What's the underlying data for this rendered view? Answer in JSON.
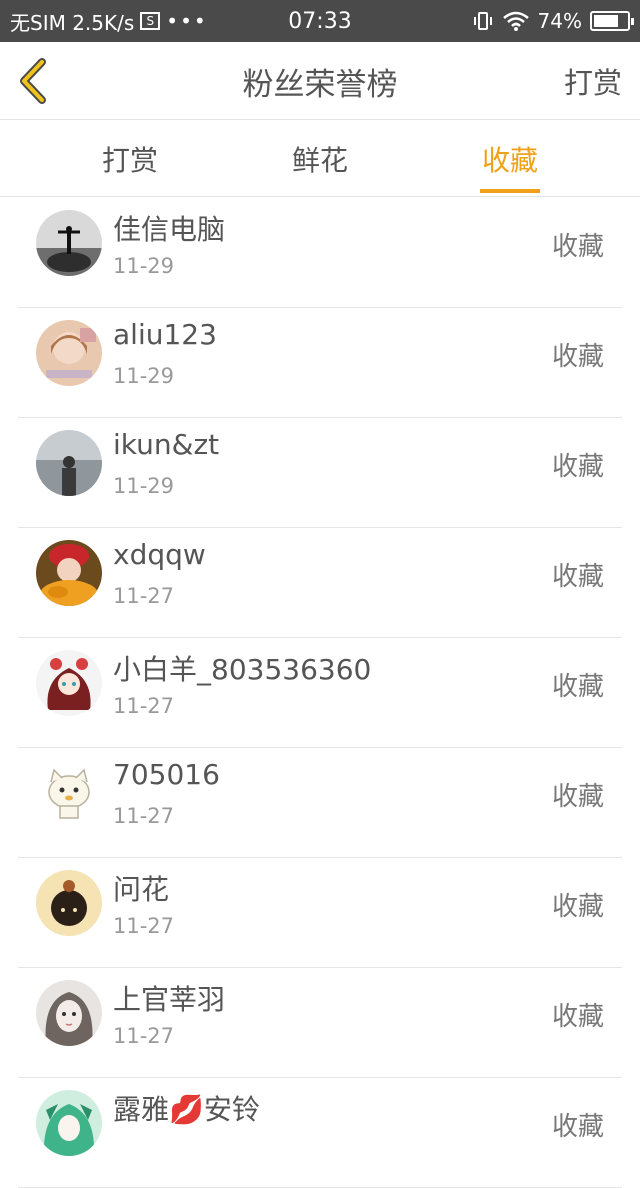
{
  "status_bar": {
    "carrier": "无SIM 2.5K/s",
    "sim_icon_label": "S",
    "more_dots": "•••",
    "time": "07:33",
    "battery": "74%",
    "battery_level": 0.74
  },
  "nav": {
    "title": "粉丝荣誉榜",
    "right_action": "打赏"
  },
  "tabs": [
    {
      "label": "打赏",
      "active": false
    },
    {
      "label": "鲜花",
      "active": false
    },
    {
      "label": "收藏",
      "active": true
    }
  ],
  "colors": {
    "accent": "#f0a11a",
    "status_bg": "#4a4a4a"
  },
  "fans": [
    {
      "name": "佳信电脑",
      "date": "11-29",
      "action": "收藏"
    },
    {
      "name": "aliu123",
      "date": "11-29",
      "action": "收藏"
    },
    {
      "name": "ikun&zt",
      "date": "11-29",
      "action": "收藏"
    },
    {
      "name": "xdqqw",
      "date": "11-27",
      "action": "收藏"
    },
    {
      "name": "小白羊_803536360",
      "date": "11-27",
      "action": "收藏"
    },
    {
      "name": "705016",
      "date": "11-27",
      "action": "收藏"
    },
    {
      "name": "问花",
      "date": "11-27",
      "action": "收藏"
    },
    {
      "name": "上官莘羽",
      "date": "11-27",
      "action": "收藏"
    },
    {
      "name": "露雅💋安铃",
      "date": "",
      "action": "收藏"
    }
  ]
}
